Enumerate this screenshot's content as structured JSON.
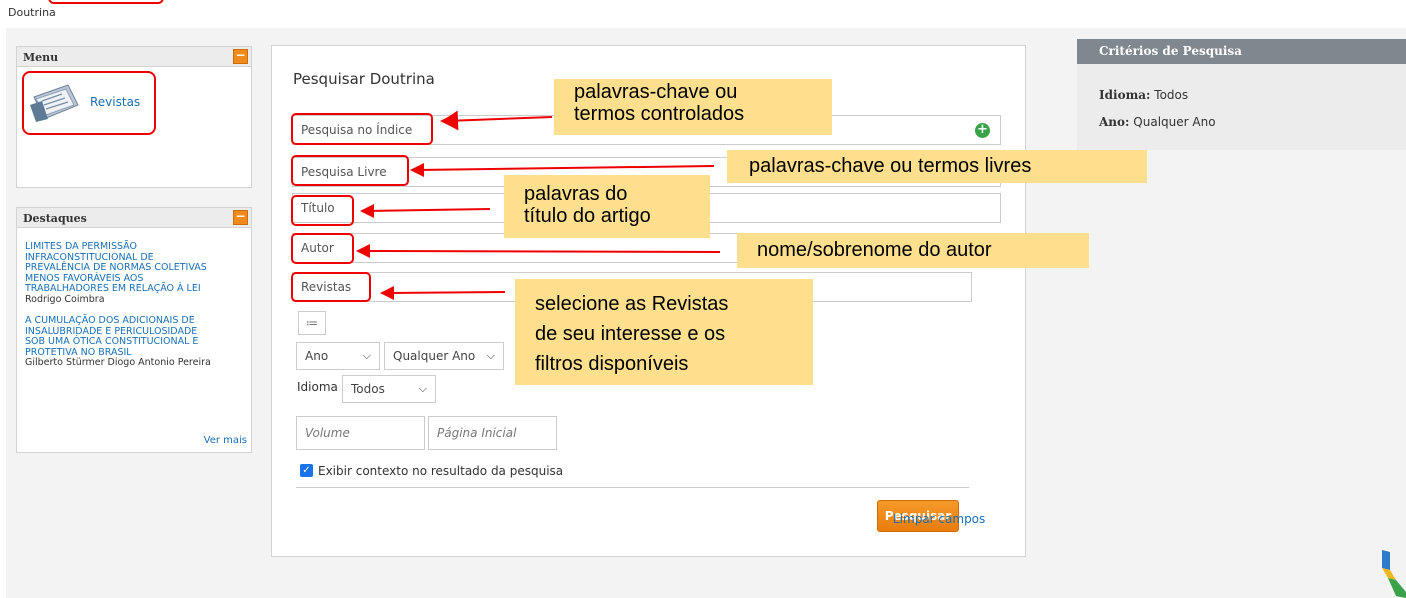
{
  "breadcrumb": "Doutrina",
  "menu": {
    "header": "Menu",
    "collapse_symbol": "−",
    "item_label": "Revistas"
  },
  "destaques": {
    "header": "Destaques",
    "collapse_symbol": "−",
    "items": [
      {
        "title_lines": [
          "LIMITES DA PERMISSÃO",
          "INFRACONSTITUCIONAL DE",
          "PREVALÊNCIA DE NORMAS COLETIVAS",
          "MENOS FAVORÁVEIS AOS",
          "TRABALHADORES EM RELAÇÃO À LEI"
        ],
        "author": "Rodrigo Coimbra"
      },
      {
        "title_lines": [
          "A CUMULAÇÃO DOS ADICIONAIS DE",
          "INSALUBRIDADE E PERICULOSIDADE",
          "SOB UMA ÓTICA CONSTITUCIONAL E",
          "PROTETIVA NO BRASIL"
        ],
        "author": "Gilberto Stürmer Diogo Antonio Pereira"
      }
    ],
    "more_label": "Ver mais"
  },
  "form": {
    "title": "Pesquisar Doutrina",
    "fields": {
      "indice": "Pesquisa no Índice",
      "livre": "Pesquisa Livre",
      "titulo": "Título",
      "autor": "Autor",
      "revistas": "Revistas"
    },
    "add_symbol": "+",
    "list_symbol": "≔",
    "ano_select": "Ano",
    "ano_value_select": "Qualquer Ano",
    "idioma_label": "Idioma",
    "idioma_select": "Todos",
    "volume_placeholder": "Volume",
    "pagina_placeholder": "Página Inicial",
    "context_checkbox_label": "Exibir contexto no resultado da pesquisa",
    "search_button": "Pesquisar",
    "clear_link": "Limpar campos"
  },
  "criterios": {
    "header": "Critérios de Pesquisa",
    "idioma_key": "Idioma:",
    "idioma_val": "Todos",
    "ano_key": "Ano:",
    "ano_val": "Qualquer Ano"
  },
  "annotations": {
    "note1": [
      "palavras-chave ou",
      "termos controlados"
    ],
    "note2": "palavras-chave ou termos livres",
    "note3": [
      "palavras do",
      "título do artigo"
    ],
    "note4": "nome/sobrenome do autor",
    "note5": [
      "selecione as Revistas",
      "de seu interesse e os",
      "filtros disponíveis"
    ]
  },
  "colors": {
    "accent_orange": "#f08a1c",
    "link_blue": "#1a6fb5",
    "annotation_red": "#e00000",
    "note_yellow": "#fddf8e",
    "criteria_header": "#7f878f"
  }
}
